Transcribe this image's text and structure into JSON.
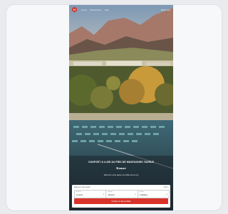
{
  "nav": {
    "logo": "H",
    "links": [
      "Hotel",
      "Restaurant",
      "Spa"
    ],
    "right": "Book now"
  },
  "hero": {
    "headline": "CONFORT & LUXE AU PIED DE MONTAGNES TAURUS",
    "place": "Kemer",
    "subline": "Réservez votre séjour et profitez de la vue"
  },
  "booking": {
    "title": "Réserver votre séjour",
    "link": "Offres",
    "fields": [
      {
        "label": "Arrivée",
        "value": "11 avril"
      },
      {
        "label": "Départ",
        "value": "18 avril"
      },
      {
        "label": "Invités",
        "value": "2 adultes"
      }
    ],
    "submit_label": "Vérifier la disponibilité"
  },
  "colors": {
    "accent": "#d8332b",
    "card_bg": "#f7f8fa"
  }
}
